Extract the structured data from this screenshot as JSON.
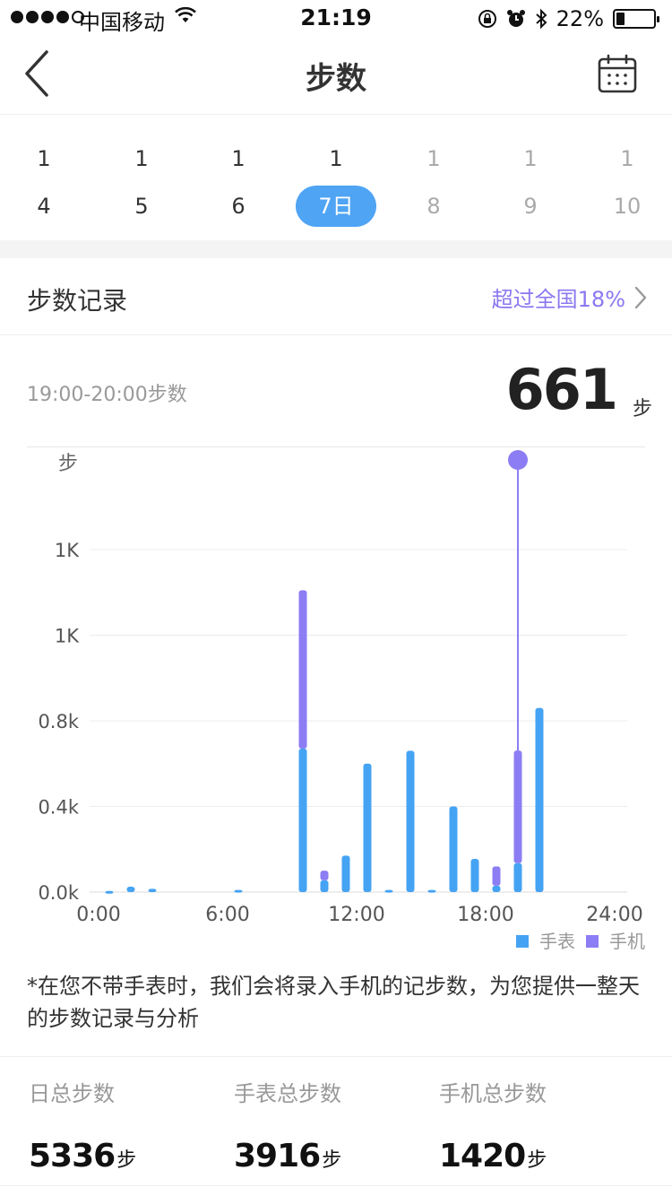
{
  "status_bar": {
    "carrier": "中国移动",
    "time": "21:19",
    "battery_percent": "22%",
    "battery_level": 0.22
  },
  "nav": {
    "title": "步数"
  },
  "dates": [
    {
      "month": "1",
      "day": "4",
      "state": "past"
    },
    {
      "month": "1",
      "day": "5",
      "state": "past"
    },
    {
      "month": "1",
      "day": "6",
      "state": "past"
    },
    {
      "month": "1",
      "day": "7日",
      "state": "active"
    },
    {
      "month": "1",
      "day": "8",
      "state": "future"
    },
    {
      "month": "1",
      "day": "9",
      "state": "future"
    },
    {
      "month": "1",
      "day": "10",
      "state": "future"
    }
  ],
  "record": {
    "label": "步数记录",
    "compare": "超过全国18%"
  },
  "selected": {
    "range": "19:00-20:00步数",
    "value": "661",
    "unit": "步"
  },
  "chart_data": {
    "type": "bar",
    "stacked": true,
    "ylabel": "步",
    "yticks": [
      "0.0k",
      "0.4k",
      "0.8k",
      "1K",
      "1K"
    ],
    "ytick_values": [
      0,
      400,
      800,
      1200,
      1600
    ],
    "ylim": [
      0,
      1600
    ],
    "xticks": [
      "0:00",
      "6:00",
      "12:00",
      "18:00",
      "24:00"
    ],
    "xtick_values": [
      0,
      6,
      12,
      18,
      24
    ],
    "xlim": [
      0,
      24
    ],
    "x": [
      0,
      1,
      2,
      6,
      9,
      10,
      11,
      12,
      13,
      14,
      15,
      16,
      17,
      18,
      19,
      20
    ],
    "series": [
      {
        "name": "手表",
        "color": "#45a3f4",
        "values": [
          5,
          25,
          15,
          10,
          670,
          55,
          170,
          600,
          10,
          660,
          10,
          400,
          155,
          30,
          135,
          860
        ]
      },
      {
        "name": "手机",
        "color": "#8c7df4",
        "values": [
          0,
          0,
          0,
          0,
          740,
          45,
          0,
          0,
          0,
          0,
          0,
          0,
          0,
          90,
          526,
          0
        ]
      }
    ],
    "highlight_x": 19,
    "grid": true,
    "legend": "bottom-right"
  },
  "note": "*在您不带手表时，我们会将录入手机的记步数，为您提供一整天的步数记录与分析",
  "totals": [
    {
      "label": "日总步数",
      "value": "5336",
      "unit": "步"
    },
    {
      "label": "手表总步数",
      "value": "3916",
      "unit": "步"
    },
    {
      "label": "手机总步数",
      "value": "1420",
      "unit": "步"
    }
  ]
}
